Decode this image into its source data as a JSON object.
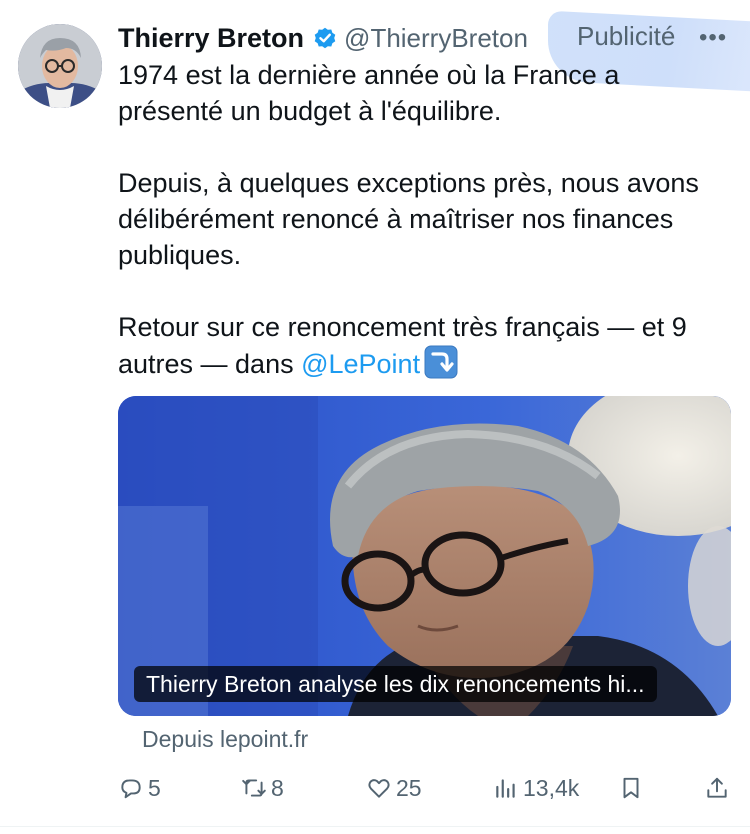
{
  "tweet": {
    "author_name": "Thierry Breton",
    "author_handle": "@ThierryBreton",
    "promoted_label": "Publicité",
    "more_label": "•••",
    "paragraphs": {
      "p1": "1974 est la dernière année où la France a présenté un budget à l'équilibre.",
      "p2": "Depuis, à quelques exceptions près, nous avons délibérément renoncé à maîtriser nos finances publiques.",
      "p3_text": "Retour sur ce renoncement très français — et 9 autres — dans ",
      "p3_mention": "@LePoint"
    },
    "emoji": "arrow-curving-down-emoji"
  },
  "card": {
    "title": "Thierry Breton analyse les dix renoncements hi...",
    "source": "Depuis lepoint.fr"
  },
  "actions": {
    "replies": "5",
    "retweets": "8",
    "likes": "25",
    "views": "13,4k"
  },
  "colors": {
    "accent": "#1d9bf0",
    "secondary_text": "#536471",
    "verified": "#1d9bf0",
    "highlight": "#c2d6f8"
  }
}
